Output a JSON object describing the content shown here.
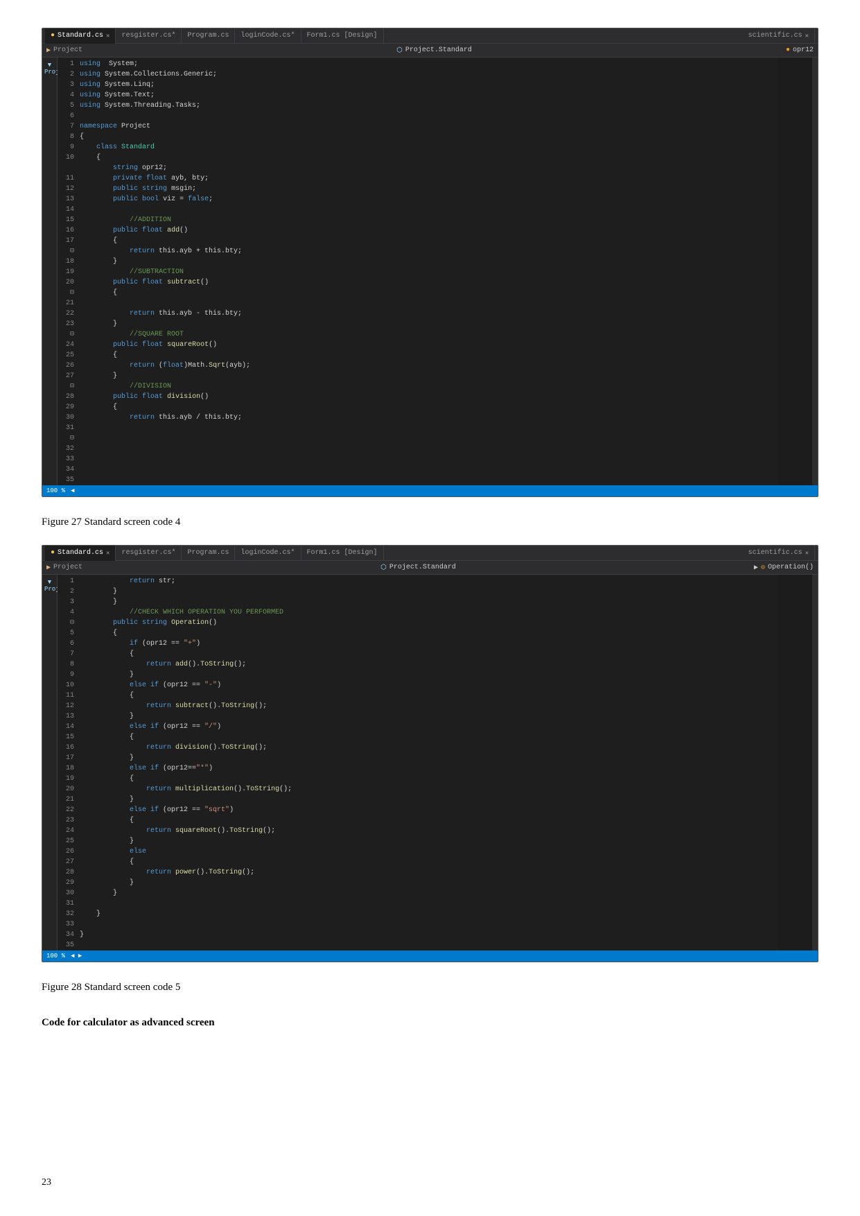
{
  "page": {
    "number": "23"
  },
  "figure27": {
    "caption": "Figure 27 Standard screen code 4",
    "tabs": [
      {
        "label": "Standard.cs",
        "active": true,
        "modified": true,
        "close": "●"
      },
      {
        "label": "resgister.cs*",
        "active": false
      },
      {
        "label": "Program.cs",
        "active": false
      },
      {
        "label": "loginCode.cs*",
        "active": false
      },
      {
        "label": "Form1.cs [Design]",
        "active": false
      },
      {
        "label": "scientific.cs",
        "active": false
      }
    ],
    "toolbar_left": "Project",
    "toolbar_middle": "Project.Standard",
    "toolbar_right": "opr12",
    "code_lines": [
      "using System;",
      "using System.Collections.Generic;",
      "using System.Linq;",
      "using System.Text;",
      "using System.Threading.Tasks;",
      "",
      "namespace Project",
      "{",
      "    class Standard",
      "    {",
      "        string opr12;",
      "        private float ayb, bty;",
      "        public string msgin;",
      "        public bool viz = false;",
      "",
      "            //ADDITION",
      "        public float add()",
      "        {",
      "            return this.ayb + this.bty;",
      "        }",
      "            //SUBTRACTION",
      "        public float subtract()",
      "        {",
      "",
      "            return this.ayb - this.bty;",
      "        }",
      "            //SQUARE ROOT",
      "        public float squareRoot()",
      "        {",
      "            return (float)Math.Sqrt(ayb);",
      "        }",
      "            //DIVISION",
      "        public float division()",
      "        {",
      "            return this.ayb / this.bty;"
    ]
  },
  "figure28": {
    "caption": "Figure 28 Standard screen code 5",
    "tabs": [
      {
        "label": "Standard.cs",
        "active": true,
        "modified": true,
        "close": "●"
      },
      {
        "label": "resgister.cs*",
        "active": false
      },
      {
        "label": "Program.cs",
        "active": false
      },
      {
        "label": "loginCode.cs*",
        "active": false
      },
      {
        "label": "Form1.cs [Design]",
        "active": false
      },
      {
        "label": "scientific.cs",
        "active": false
      }
    ],
    "toolbar_left": "Project",
    "toolbar_middle": "Project.Standard",
    "toolbar_right": "Operation()",
    "code_lines": [
      "            return str;",
      "        }",
      "        }",
      "            //CHECK WHICH OPERATION YOU PERFORMED",
      "        public string Operation()",
      "        {",
      "            if (opr12 == \"+\")",
      "            {",
      "                return add().ToString();",
      "            }",
      "            else if (opr12 == \"-\")",
      "            {",
      "                return subtract().ToString();",
      "            }",
      "            else if (opr12 == \"/\")",
      "            {",
      "                return division().ToString();",
      "            }",
      "            else if (opr12==\"*\")",
      "            {",
      "                return multiplication().ToString();",
      "            }",
      "            else if (opr12 == \"sqrt\")",
      "            {",
      "                return squareRoot().ToString();",
      "            }",
      "            else",
      "            {",
      "                return power().ToString();",
      "            }",
      "        }",
      "",
      "    }",
      "",
      "}"
    ]
  },
  "section_heading": "Code for calculator as advanced screen"
}
